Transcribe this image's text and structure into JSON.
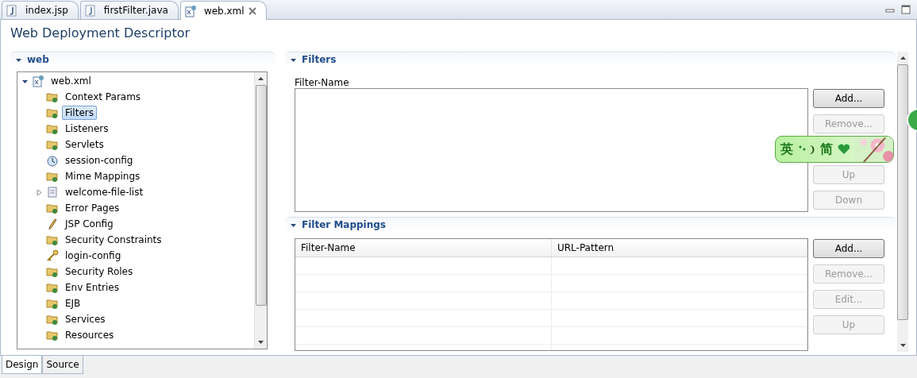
{
  "editor_tabs": [
    {
      "label": "index.jsp",
      "kind": "jsp",
      "selected": false
    },
    {
      "label": "firstFilter.java",
      "kind": "java",
      "selected": false
    },
    {
      "label": "web.xml",
      "kind": "xml",
      "selected": true
    }
  ],
  "title": "Web Deployment Descriptor",
  "left_section": {
    "title": "web",
    "expanded": true,
    "tree": [
      {
        "label": "web.xml",
        "kind": "xml",
        "selected": false,
        "expanded": true,
        "children": [
          {
            "label": "Context Params",
            "kind": "folder",
            "selected": false
          },
          {
            "label": "Filters",
            "kind": "folder",
            "selected": true
          },
          {
            "label": "Listeners",
            "kind": "folder",
            "selected": false
          },
          {
            "label": "Servlets",
            "kind": "folder",
            "selected": false
          },
          {
            "label": "session-config",
            "kind": "clock",
            "selected": false
          },
          {
            "label": "Mime Mappings",
            "kind": "folder",
            "selected": false
          },
          {
            "label": "welcome-file-list",
            "kind": "page",
            "selected": false,
            "expanded": false
          },
          {
            "label": "Error Pages",
            "kind": "folder",
            "selected": false
          },
          {
            "label": "JSP Config",
            "kind": "pencil",
            "selected": false
          },
          {
            "label": "Security Constraints",
            "kind": "folder",
            "selected": false
          },
          {
            "label": "login-config",
            "kind": "key",
            "selected": false
          },
          {
            "label": "Security Roles",
            "kind": "folder",
            "selected": false
          },
          {
            "label": "Env Entries",
            "kind": "folder",
            "selected": false
          },
          {
            "label": "EJB",
            "kind": "folder",
            "selected": false
          },
          {
            "label": "Services",
            "kind": "folder",
            "selected": false
          },
          {
            "label": "Resources",
            "kind": "folder",
            "selected": false
          }
        ]
      }
    ]
  },
  "filters_section": {
    "title": "Filters",
    "expanded": true,
    "list_label": "Filter-Name",
    "buttons": [
      {
        "label": "Add...",
        "disabled": false
      },
      {
        "label": "Remove...",
        "disabled": true
      },
      {
        "label": "Up",
        "disabled": true
      },
      {
        "label": "Down",
        "disabled": true
      }
    ]
  },
  "mappings_section": {
    "title": "Filter Mappings",
    "expanded": true,
    "columns": [
      "Filter-Name",
      "URL-Pattern"
    ],
    "buttons": [
      {
        "label": "Add...",
        "disabled": false
      },
      {
        "label": "Remove...",
        "disabled": true
      },
      {
        "label": "Edit...",
        "disabled": true
      },
      {
        "label": "Up",
        "disabled": true
      }
    ]
  },
  "ime_bar": {
    "language": "英",
    "script": "简"
  },
  "page_tabs": [
    {
      "label": "Design",
      "selected": true
    },
    {
      "label": "Source",
      "selected": false
    }
  ]
}
